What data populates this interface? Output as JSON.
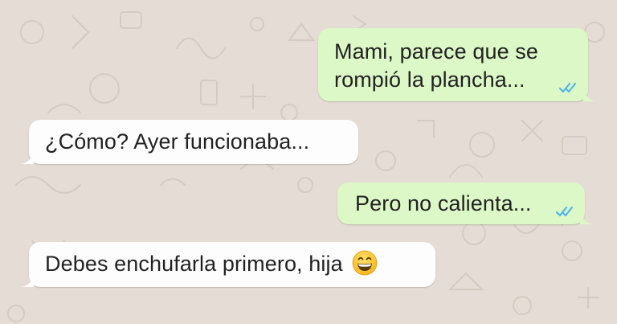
{
  "chat": {
    "messages": [
      {
        "direction": "outgoing",
        "line1": "Mami, parece que se",
        "line2": "rompió la plancha...",
        "status_icon": "double-check-read-icon"
      },
      {
        "direction": "incoming",
        "text": "¿Cómo? Ayer funcionaba..."
      },
      {
        "direction": "outgoing",
        "text": "Pero no calienta...",
        "status_icon": "double-check-read-icon"
      },
      {
        "direction": "incoming",
        "text": "Debes enchufarla primero, hija",
        "emoji": "grinning-face-icon"
      }
    ]
  },
  "colors": {
    "wallpaper": "#e5ddd5",
    "outgoing_bubble": "#dcf8c6",
    "incoming_bubble": "#fdfdfd",
    "read_ticks": "#4fb6ec"
  }
}
